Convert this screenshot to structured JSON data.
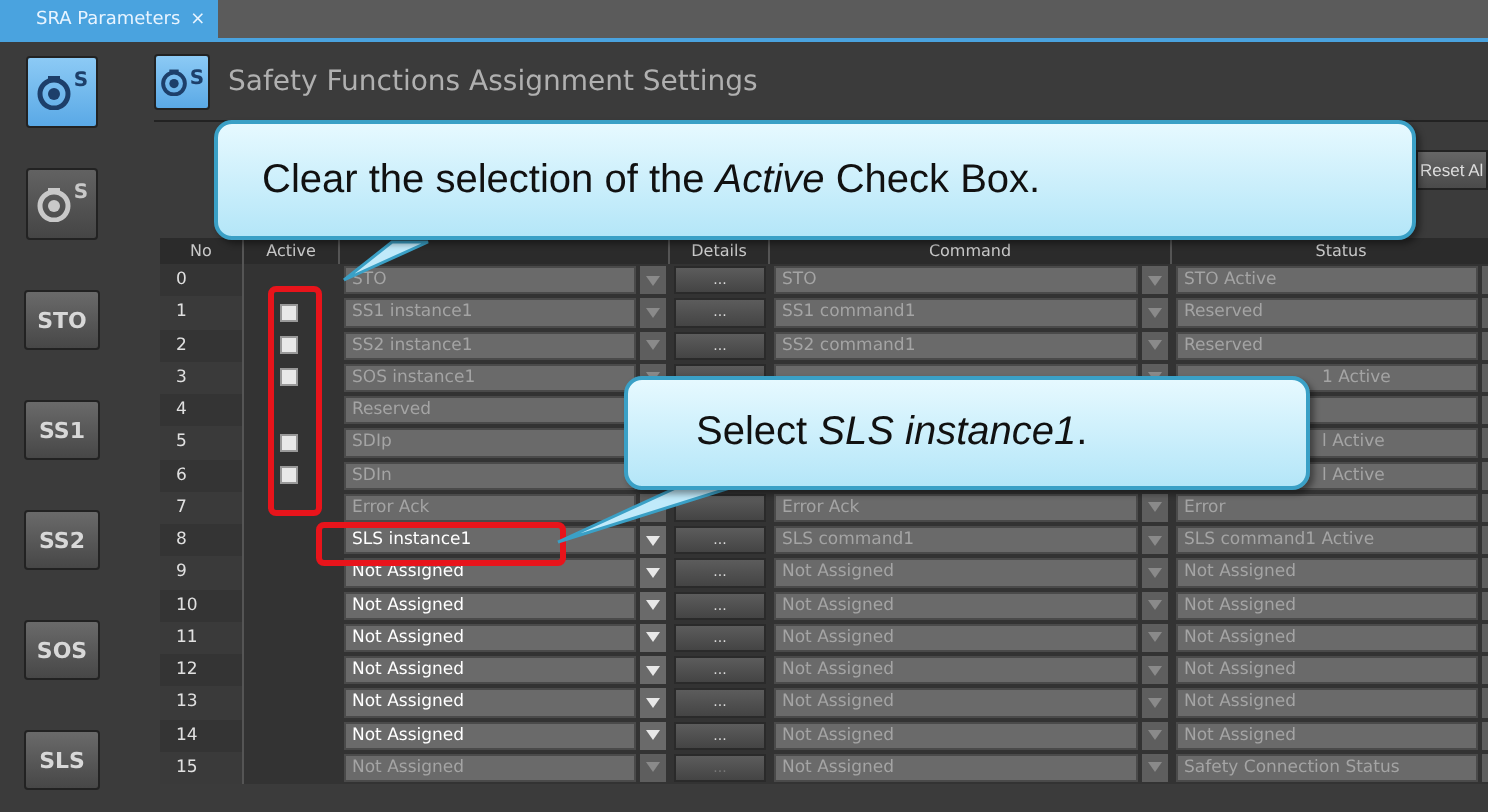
{
  "tab": {
    "title": "SRA Parameters",
    "close": "×"
  },
  "sidebar": {
    "tools": [
      {
        "label": "S",
        "selected": true
      },
      {
        "label": "S",
        "selected": false
      }
    ],
    "functions": [
      {
        "label": "STO"
      },
      {
        "label": "SS1"
      },
      {
        "label": "SS2"
      },
      {
        "label": "SOS"
      },
      {
        "label": "SLS"
      }
    ]
  },
  "header": {
    "icon_label": "S",
    "title": "Safety Functions Assignment Settings"
  },
  "toolbar": {
    "reset_button": "Reset Al"
  },
  "table": {
    "columns": [
      "No",
      "Active",
      null,
      "Details",
      "Command",
      "Status"
    ],
    "rows": [
      {
        "no": "0",
        "function": {
          "text": "STO",
          "disabled": true
        },
        "details": {
          "text": "...",
          "disabled": false
        },
        "command": {
          "text": "STO",
          "disabled": true
        },
        "status": {
          "text": "STO Active",
          "covered": false
        }
      },
      {
        "no": "1",
        "active": {
          "checked": false
        },
        "function": {
          "text": "SS1 instance1",
          "disabled": true
        },
        "details": {
          "text": "...",
          "disabled": false
        },
        "command": {
          "text": "SS1 command1",
          "disabled": true
        },
        "status": {
          "text": "Reserved",
          "covered": false
        }
      },
      {
        "no": "2",
        "active": {
          "checked": false
        },
        "function": {
          "text": "SS2 instance1",
          "disabled": true
        },
        "details": {
          "text": "...",
          "disabled": false
        },
        "command": {
          "text": "SS2 command1",
          "disabled": true
        },
        "status": {
          "text": "Reserved",
          "covered": false
        }
      },
      {
        "no": "3",
        "active": {
          "checked": false
        },
        "function": {
          "text": "SOS instance1",
          "disabled": true
        },
        "details": {
          "kind": "button"
        },
        "command": {
          "kind": "dropdown"
        },
        "status": {
          "text": "1 Active",
          "covered": true
        }
      },
      {
        "no": "4",
        "function": {
          "text": "Reserved",
          "disabled": true
        },
        "status": {
          "kind": "dropdown"
        }
      },
      {
        "no": "5",
        "active": {
          "checked": false
        },
        "function": {
          "text": "SDIp",
          "disabled": true
        },
        "status": {
          "text": "l Active",
          "covered": true
        }
      },
      {
        "no": "6",
        "active": {
          "checked": false
        },
        "function": {
          "text": "SDIn",
          "disabled": true
        },
        "status": {
          "text": "l Active",
          "covered": true
        }
      },
      {
        "no": "7",
        "function": {
          "text": "Error Ack",
          "disabled": true
        },
        "details": {
          "kind": "button"
        },
        "command": {
          "text": "Error Ack",
          "disabled": true
        },
        "status": {
          "text": "Error",
          "covered": false
        }
      },
      {
        "no": "8",
        "function": {
          "text": "SLS instance1",
          "disabled": false
        },
        "details": {
          "text": "...",
          "disabled": false
        },
        "command": {
          "text": "SLS command1",
          "disabled": true
        },
        "status": {
          "text": "SLS command1 Active",
          "covered": false
        }
      },
      {
        "no": "9",
        "function": {
          "text": "Not Assigned",
          "disabled": false
        },
        "details": {
          "text": "...",
          "disabled": false
        },
        "command": {
          "text": "Not Assigned",
          "disabled": true
        },
        "status": {
          "text": "Not Assigned",
          "covered": false
        }
      },
      {
        "no": "10",
        "function": {
          "text": "Not Assigned",
          "disabled": false
        },
        "details": {
          "text": "...",
          "disabled": false
        },
        "command": {
          "text": "Not Assigned",
          "disabled": true
        },
        "status": {
          "text": "Not Assigned",
          "covered": false
        }
      },
      {
        "no": "11",
        "function": {
          "text": "Not Assigned",
          "disabled": false
        },
        "details": {
          "text": "...",
          "disabled": false
        },
        "command": {
          "text": "Not Assigned",
          "disabled": true
        },
        "status": {
          "text": "Not Assigned",
          "covered": false
        }
      },
      {
        "no": "12",
        "function": {
          "text": "Not Assigned",
          "disabled": false
        },
        "details": {
          "text": "...",
          "disabled": false
        },
        "command": {
          "text": "Not Assigned",
          "disabled": true
        },
        "status": {
          "text": "Not Assigned",
          "covered": false
        }
      },
      {
        "no": "13",
        "function": {
          "text": "Not Assigned",
          "disabled": false
        },
        "details": {
          "text": "...",
          "disabled": false
        },
        "command": {
          "text": "Not Assigned",
          "disabled": true
        },
        "status": {
          "text": "Not Assigned",
          "covered": false
        }
      },
      {
        "no": "14",
        "function": {
          "text": "Not Assigned",
          "disabled": false
        },
        "details": {
          "text": "...",
          "disabled": false
        },
        "command": {
          "text": "Not Assigned",
          "disabled": true
        },
        "status": {
          "text": "Not Assigned",
          "covered": false
        }
      },
      {
        "no": "15",
        "function": {
          "text": "Not Assigned",
          "disabled": true
        },
        "details": {
          "text": "...",
          "disabled": true
        },
        "command": {
          "text": "Not Assigned",
          "disabled": true
        },
        "status": {
          "text": "Safety Connection Status",
          "covered": false
        }
      }
    ]
  },
  "callouts": [
    {
      "text": "Clear the selection of the *Active* Check Box."
    },
    {
      "text": "Select *SLS instance1*."
    }
  ]
}
